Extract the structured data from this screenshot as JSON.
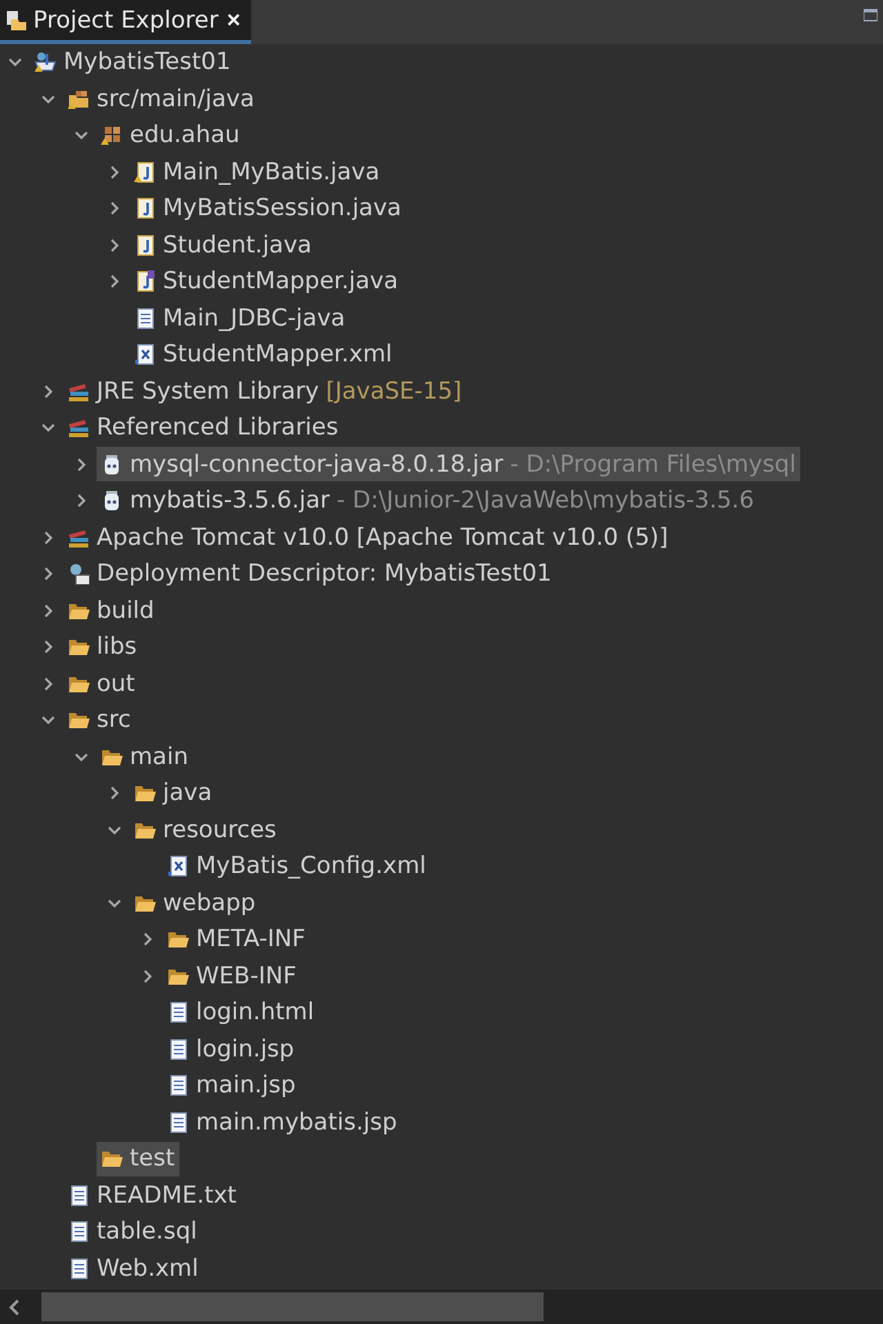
{
  "view_tab": {
    "title": "Project Explorer",
    "close": "×",
    "selected": true
  },
  "tree": [
    {
      "label": "MybatisTest01",
      "kind": "project",
      "expanded": true,
      "selected": false,
      "children": [
        {
          "label": "src/main/java",
          "kind": "source-folder",
          "expanded": true,
          "selected": false,
          "children": [
            {
              "label": "edu.ahau",
              "kind": "package",
              "expanded": true,
              "selected": false,
              "children": [
                {
                  "label": "Main_MyBatis.java",
                  "kind": "java-warning",
                  "expanded": false,
                  "selected": false
                },
                {
                  "label": "MyBatisSession.java",
                  "kind": "java",
                  "expanded": false,
                  "selected": false
                },
                {
                  "label": "Student.java",
                  "kind": "java",
                  "expanded": false,
                  "selected": false
                },
                {
                  "label": "StudentMapper.java",
                  "kind": "java-interface",
                  "expanded": false,
                  "selected": false
                },
                {
                  "label": "Main_JDBC-java",
                  "kind": "text",
                  "selected": false
                },
                {
                  "label": "StudentMapper.xml",
                  "kind": "xml",
                  "selected": false
                }
              ]
            }
          ]
        },
        {
          "label": "JRE System Library",
          "kind": "library",
          "expanded": false,
          "selected": false,
          "decoration": {
            "text": "[JavaSE-15]",
            "kind": "version"
          }
        },
        {
          "label": "Referenced Libraries",
          "kind": "library",
          "expanded": true,
          "selected": false,
          "children": [
            {
              "label": "mysql-connector-java-8.0.18.jar",
              "kind": "jar",
              "expanded": false,
              "selected": true,
              "decoration": {
                "text": "- D:\\Program Files\\mysql",
                "kind": "path"
              }
            },
            {
              "label": "mybatis-3.5.6.jar",
              "kind": "jar",
              "expanded": false,
              "selected": false,
              "decoration": {
                "text": "- D:\\Junior-2\\JavaWeb\\mybatis-3.5.6",
                "kind": "path"
              }
            }
          ]
        },
        {
          "label": "Apache Tomcat v10.0 [Apache Tomcat v10.0 (5)]",
          "kind": "library",
          "expanded": false,
          "selected": false
        },
        {
          "label": "Deployment Descriptor: MybatisTest01",
          "kind": "descriptor",
          "expanded": false,
          "selected": false
        },
        {
          "label": "build",
          "kind": "folder",
          "expanded": false,
          "selected": false
        },
        {
          "label": "libs",
          "kind": "folder",
          "expanded": false,
          "selected": false
        },
        {
          "label": "out",
          "kind": "folder",
          "expanded": false,
          "selected": false
        },
        {
          "label": "src",
          "kind": "folder",
          "expanded": true,
          "selected": false,
          "children": [
            {
              "label": "main",
              "kind": "folder",
              "expanded": true,
              "selected": false,
              "children": [
                {
                  "label": "java",
                  "kind": "folder",
                  "expanded": false,
                  "selected": false
                },
                {
                  "label": "resources",
                  "kind": "folder",
                  "expanded": true,
                  "selected": false,
                  "children": [
                    {
                      "label": "MyBatis_Config.xml",
                      "kind": "xml",
                      "selected": false
                    }
                  ]
                },
                {
                  "label": "webapp",
                  "kind": "folder",
                  "expanded": true,
                  "selected": false,
                  "children": [
                    {
                      "label": "META-INF",
                      "kind": "folder",
                      "expanded": false,
                      "selected": false
                    },
                    {
                      "label": "WEB-INF",
                      "kind": "folder",
                      "expanded": false,
                      "selected": false
                    },
                    {
                      "label": "login.html",
                      "kind": "text",
                      "selected": false
                    },
                    {
                      "label": "login.jsp",
                      "kind": "text",
                      "selected": false
                    },
                    {
                      "label": "main.jsp",
                      "kind": "text",
                      "selected": false
                    },
                    {
                      "label": "main.mybatis.jsp",
                      "kind": "text",
                      "selected": false
                    }
                  ]
                }
              ]
            },
            {
              "label": "test",
              "kind": "folder",
              "selected": true
            }
          ]
        },
        {
          "label": "README.txt",
          "kind": "text",
          "selected": false
        },
        {
          "label": "table.sql",
          "kind": "text",
          "selected": false
        },
        {
          "label": "Web.xml",
          "kind": "text",
          "selected": false
        }
      ]
    }
  ]
}
